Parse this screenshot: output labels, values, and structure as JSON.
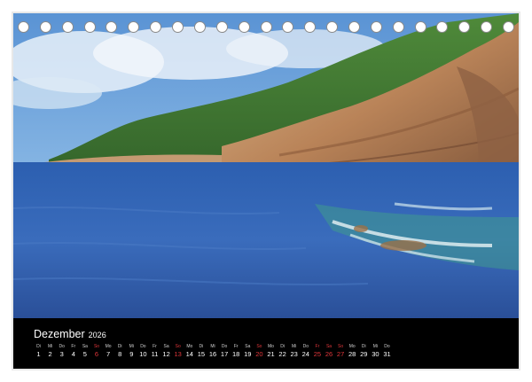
{
  "calendar": {
    "month": "Dezember",
    "year": "2026",
    "days": [
      {
        "wd": "Di",
        "d": "1"
      },
      {
        "wd": "Mi",
        "d": "2"
      },
      {
        "wd": "Do",
        "d": "3"
      },
      {
        "wd": "Fr",
        "d": "4"
      },
      {
        "wd": "Sa",
        "d": "5"
      },
      {
        "wd": "So",
        "d": "6",
        "sunday": true
      },
      {
        "wd": "Mo",
        "d": "7"
      },
      {
        "wd": "Di",
        "d": "8"
      },
      {
        "wd": "Mi",
        "d": "9"
      },
      {
        "wd": "Do",
        "d": "10"
      },
      {
        "wd": "Fr",
        "d": "11"
      },
      {
        "wd": "Sa",
        "d": "12"
      },
      {
        "wd": "So",
        "d": "13",
        "sunday": true
      },
      {
        "wd": "Mo",
        "d": "14"
      },
      {
        "wd": "Di",
        "d": "15"
      },
      {
        "wd": "Mi",
        "d": "16"
      },
      {
        "wd": "Do",
        "d": "17"
      },
      {
        "wd": "Fr",
        "d": "18"
      },
      {
        "wd": "Sa",
        "d": "19"
      },
      {
        "wd": "So",
        "d": "20",
        "sunday": true
      },
      {
        "wd": "Mo",
        "d": "21"
      },
      {
        "wd": "Di",
        "d": "22"
      },
      {
        "wd": "Mi",
        "d": "23"
      },
      {
        "wd": "Do",
        "d": "24"
      },
      {
        "wd": "Fr",
        "d": "25",
        "sunday": true
      },
      {
        "wd": "Sa",
        "d": "26",
        "sunday": true
      },
      {
        "wd": "So",
        "d": "27",
        "sunday": true
      },
      {
        "wd": "Mo",
        "d": "28"
      },
      {
        "wd": "Di",
        "d": "29"
      },
      {
        "wd": "Mi",
        "d": "30"
      },
      {
        "wd": "Do",
        "d": "31"
      }
    ]
  },
  "binding_ring_count": 23,
  "colors": {
    "band": "#000000",
    "holiday": "#e0363a",
    "sea": "#2f5fa8",
    "sky": "#6fa6dc"
  }
}
